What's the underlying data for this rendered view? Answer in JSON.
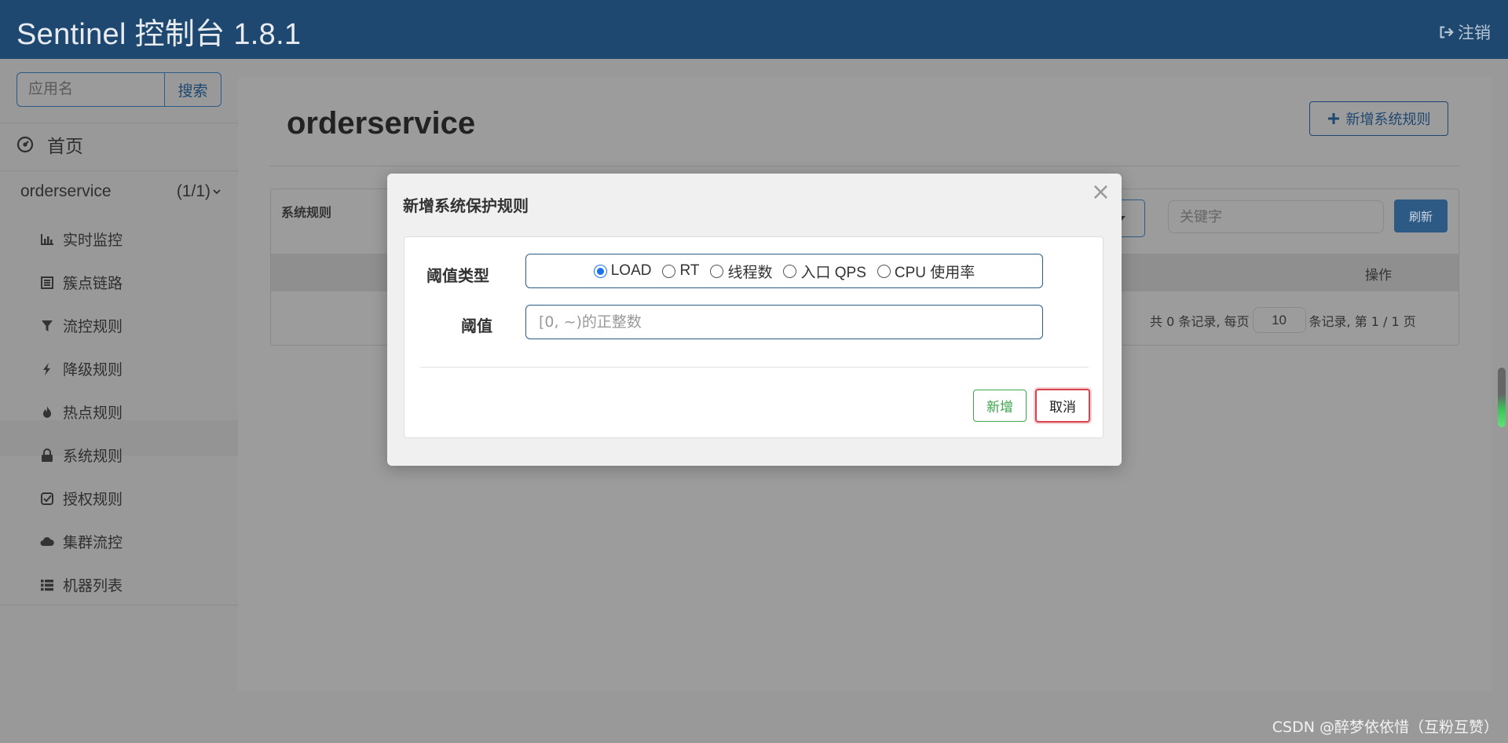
{
  "header": {
    "title": "Sentinel 控制台 1.8.1",
    "logout_label": "注销"
  },
  "sidebar": {
    "search_placeholder": "应用名",
    "search_button": "搜索",
    "home_label": "首页",
    "app_name": "orderservice",
    "app_count": "(1/1)",
    "items": [
      {
        "label": "实时监控",
        "icon": "bar-chart-icon"
      },
      {
        "label": "簇点链路",
        "icon": "list-alt-icon"
      },
      {
        "label": "流控规则",
        "icon": "filter-icon"
      },
      {
        "label": "降级规则",
        "icon": "flash-icon"
      },
      {
        "label": "热点规则",
        "icon": "fire-icon"
      },
      {
        "label": "系统规则",
        "icon": "lock-icon"
      },
      {
        "label": "授权规则",
        "icon": "check-square-icon"
      },
      {
        "label": "集群流控",
        "icon": "cloud-icon"
      },
      {
        "label": "机器列表",
        "icon": "list-icon"
      }
    ]
  },
  "main": {
    "page_title": "orderservice",
    "add_rule_button": "新增系统规则",
    "panel_title": "系统规则",
    "keyword_placeholder": "关键字",
    "refresh_button": "刷新",
    "table_header_operation": "操作",
    "pager": {
      "prefix": "共 0 条记录, 每页",
      "page_size": "10",
      "suffix": "条记录, 第 1 / 1 页"
    }
  },
  "modal": {
    "title": "新增系统保护规则",
    "close_symbol": "×",
    "threshold_type_label": "阈值类型",
    "threshold_types": [
      "LOAD",
      "RT",
      "线程数",
      "入口 QPS",
      "CPU 使用率"
    ],
    "selected_threshold_type": "LOAD",
    "threshold_label": "阈值",
    "threshold_placeholder": "[0, ~)的正整数",
    "confirm_button": "新增",
    "cancel_button": "取消"
  },
  "watermark": "CSDN @醉梦依依惜（互粉互赞）",
  "colors": {
    "header_bg": "#1f4870",
    "primary": "#2d5a85",
    "success": "#3ca64a",
    "danger": "#d9434e"
  }
}
